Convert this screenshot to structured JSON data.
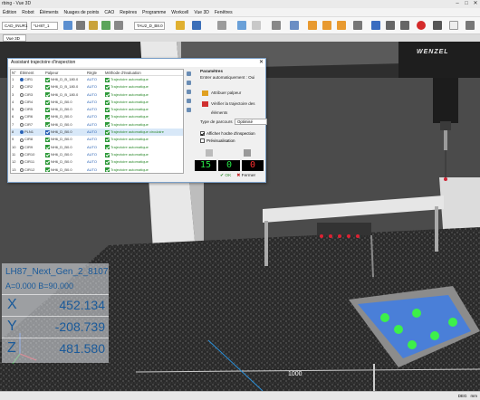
{
  "window": {
    "title": "rbing - Vue 3D"
  },
  "menu": [
    "Édition",
    "Robot",
    "Éléments",
    "Nuages de points",
    "CAO",
    "Repères",
    "Programme",
    "Workcell",
    "Vue 3D",
    "Fenêtres"
  ],
  "toolbar": {
    "machine": "CAD_INUR1",
    "probe": "*LH87_1",
    "tip": "TAU2_D_B8.0"
  },
  "tabs": [
    "Vue 3D"
  ],
  "readout": {
    "title": "LH87_Next_Gen_2_8107",
    "angles": "A=0.000 B=90.000",
    "x_label": "X",
    "x": "452.134",
    "y_label": "Y",
    "y": "-208.739",
    "z_label": "Z",
    "z": "481.580"
  },
  "viewport": {
    "logo": "WENZEL",
    "scale_label": "1000"
  },
  "dialog": {
    "title": "Assistant trajectoire d'inspection",
    "headers": {
      "num": "N°",
      "element": "Élément",
      "palpeur": "Palpeur",
      "regle": "Règle",
      "methode": "Méthode d'évaluation"
    },
    "rows": [
      {
        "n": "1",
        "el": "CIR1",
        "pa": "NH6_D_B_180.0",
        "rg": "AUTO",
        "me": "Trajectoire automatique",
        "sel": false,
        "radio": true
      },
      {
        "n": "2",
        "el": "CIR2",
        "pa": "NH6_D_B_180.0",
        "rg": "AUTO",
        "me": "Trajectoire automatique",
        "sel": false,
        "radio": false
      },
      {
        "n": "3",
        "el": "CIR3",
        "pa": "NH6_D_B_180.0",
        "rg": "AUTO",
        "me": "Trajectoire automatique",
        "sel": false,
        "radio": false
      },
      {
        "n": "4",
        "el": "CIR4",
        "pa": "NH6_D_B0.0",
        "rg": "AUTO",
        "me": "Trajectoire automatique",
        "sel": false,
        "radio": false
      },
      {
        "n": "5",
        "el": "CIR5",
        "pa": "NH6_D_B0.0",
        "rg": "AUTO",
        "me": "Trajectoire automatique",
        "sel": false,
        "radio": false
      },
      {
        "n": "6",
        "el": "CIR6",
        "pa": "NH6_D_B0.0",
        "rg": "AUTO",
        "me": "Trajectoire automatique",
        "sel": false,
        "radio": false
      },
      {
        "n": "7",
        "el": "CIR7",
        "pa": "NH6_D_B0.0",
        "rg": "AUTO",
        "me": "Trajectoire automatique",
        "sel": false,
        "radio": false
      },
      {
        "n": "8",
        "el": "PLN1",
        "pa": "NH6_D_B0.0",
        "rg": "AUTO",
        "me": "Trajectoire automatique circulaire",
        "sel": true,
        "radio": true
      },
      {
        "n": "9",
        "el": "CIR8",
        "pa": "NH6_D_B0.0",
        "rg": "AUTO",
        "me": "Trajectoire automatique",
        "sel": false,
        "radio": false
      },
      {
        "n": "10",
        "el": "CIR9",
        "pa": "NH6_D_B0.0",
        "rg": "AUTO",
        "me": "Trajectoire automatique",
        "sel": false,
        "radio": false
      },
      {
        "n": "11",
        "el": "CIR10",
        "pa": "NH6_D_B0.0",
        "rg": "AUTO",
        "me": "Trajectoire automatique",
        "sel": false,
        "radio": false
      },
      {
        "n": "12",
        "el": "CIR11",
        "pa": "NH6_D_B0.0",
        "rg": "AUTO",
        "me": "Trajectoire automatique",
        "sel": false,
        "radio": false
      },
      {
        "n": "13",
        "el": "CIR12",
        "pa": "NH6_D_B0.0",
        "rg": "AUTO",
        "me": "Trajectoire automatique",
        "sel": false,
        "radio": false
      }
    ],
    "params_title": "Paramètres",
    "auto_label": "Entrer automatiquement : Oui",
    "assign_probe": "Attribuer palpeur",
    "verify": "Vérifier la trajectoire des éléments",
    "path_type_label": "Type de parcours",
    "path_type_value": "Optimisé",
    "show_order": "Afficher l'ordre d'inspection",
    "preview": "Prévisualisation",
    "counters": [
      "15",
      "0",
      "0"
    ],
    "ok": "OK",
    "cancel": "Fermer"
  },
  "status": {
    "units": "DEG",
    "mode": "mm"
  }
}
